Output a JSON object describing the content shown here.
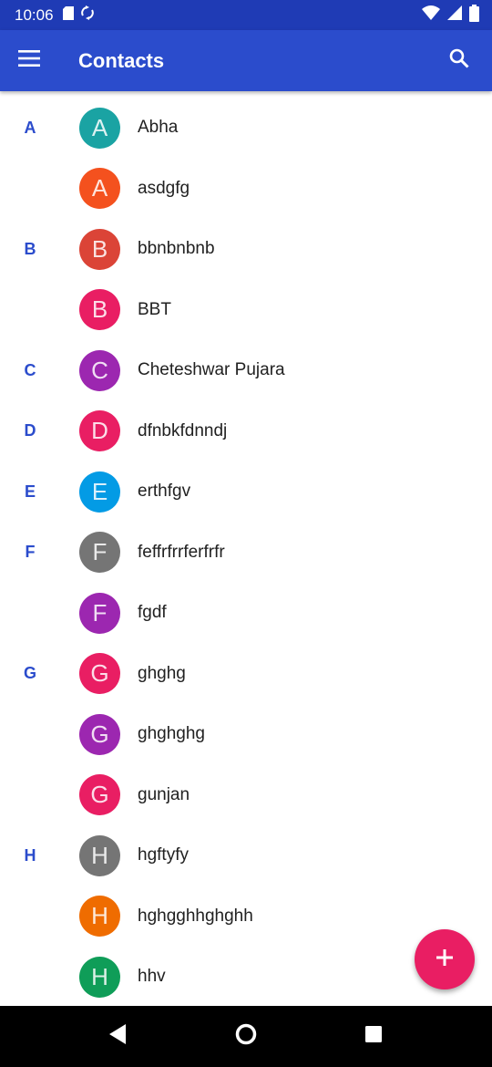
{
  "status_bar": {
    "time": "10:06",
    "icons_left": [
      "sd-card-icon",
      "sync-icon"
    ],
    "icons_right": [
      "wifi-icon",
      "signal-icon",
      "battery-icon"
    ]
  },
  "app_bar": {
    "title": "Contacts",
    "menu_icon": "hamburger-menu-icon",
    "search_icon": "search-icon"
  },
  "contacts": [
    {
      "section": "A",
      "initial": "A",
      "name": "Abha",
      "color": "#1aa3a3"
    },
    {
      "section": "",
      "initial": "A",
      "name": "asdgfg",
      "color": "#f4511e"
    },
    {
      "section": "B",
      "initial": "B",
      "name": "bbnbnbnb",
      "color": "#db4437"
    },
    {
      "section": "",
      "initial": "B",
      "name": "BBT",
      "color": "#e91e63"
    },
    {
      "section": "C",
      "initial": "C",
      "name": "Cheteshwar Pujara",
      "color": "#9c27b0"
    },
    {
      "section": "D",
      "initial": "D",
      "name": "dfnbkfdnndj",
      "color": "#e91e63"
    },
    {
      "section": "E",
      "initial": "E",
      "name": "erthfgv",
      "color": "#039be5"
    },
    {
      "section": "F",
      "initial": "F",
      "name": "feffrfrrferfrfr",
      "color": "#757575"
    },
    {
      "section": "",
      "initial": "F",
      "name": "fgdf",
      "color": "#9c27b0"
    },
    {
      "section": "G",
      "initial": "G",
      "name": "ghghg",
      "color": "#e91e63"
    },
    {
      "section": "",
      "initial": "G",
      "name": "ghghghg",
      "color": "#9c27b0"
    },
    {
      "section": "",
      "initial": "G",
      "name": "gunjan",
      "color": "#e91e63"
    },
    {
      "section": "H",
      "initial": "H",
      "name": "hgftyfy",
      "color": "#757575"
    },
    {
      "section": "",
      "initial": "H",
      "name": "hghgghhghghh",
      "color": "#ef6c00"
    },
    {
      "section": "",
      "initial": "H",
      "name": "hhv",
      "color": "#0f9d58"
    }
  ],
  "fab": {
    "icon": "plus-icon",
    "color": "#e91e63"
  },
  "nav_bar": {
    "buttons": [
      "back-icon",
      "home-icon",
      "recents-icon"
    ]
  },
  "colors": {
    "status_bar": "#1f3bb5",
    "app_bar": "#2b4ccc",
    "section_letter": "#2b4ccc"
  }
}
